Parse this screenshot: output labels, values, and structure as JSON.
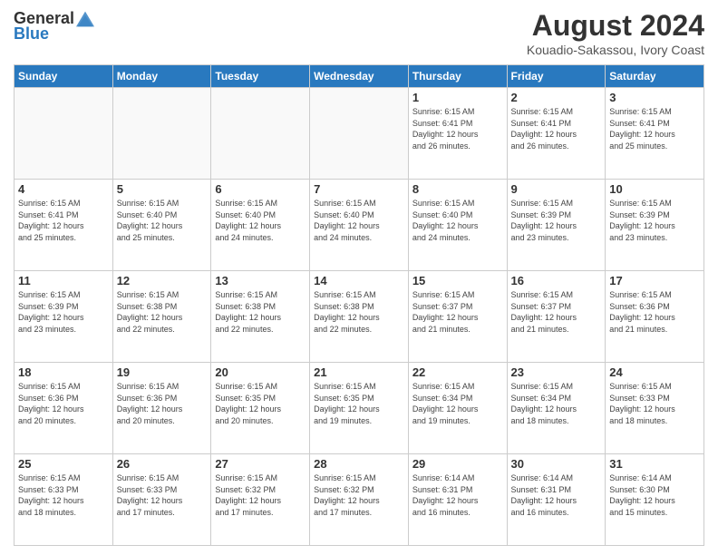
{
  "header": {
    "logo_line1": "General",
    "logo_line2": "Blue",
    "month_year": "August 2024",
    "location": "Kouadio-Sakassou, Ivory Coast"
  },
  "days_of_week": [
    "Sunday",
    "Monday",
    "Tuesday",
    "Wednesday",
    "Thursday",
    "Friday",
    "Saturday"
  ],
  "weeks": [
    [
      {
        "day": "",
        "info": ""
      },
      {
        "day": "",
        "info": ""
      },
      {
        "day": "",
        "info": ""
      },
      {
        "day": "",
        "info": ""
      },
      {
        "day": "1",
        "info": "Sunrise: 6:15 AM\nSunset: 6:41 PM\nDaylight: 12 hours\nand 26 minutes."
      },
      {
        "day": "2",
        "info": "Sunrise: 6:15 AM\nSunset: 6:41 PM\nDaylight: 12 hours\nand 26 minutes."
      },
      {
        "day": "3",
        "info": "Sunrise: 6:15 AM\nSunset: 6:41 PM\nDaylight: 12 hours\nand 25 minutes."
      }
    ],
    [
      {
        "day": "4",
        "info": "Sunrise: 6:15 AM\nSunset: 6:41 PM\nDaylight: 12 hours\nand 25 minutes."
      },
      {
        "day": "5",
        "info": "Sunrise: 6:15 AM\nSunset: 6:40 PM\nDaylight: 12 hours\nand 25 minutes."
      },
      {
        "day": "6",
        "info": "Sunrise: 6:15 AM\nSunset: 6:40 PM\nDaylight: 12 hours\nand 24 minutes."
      },
      {
        "day": "7",
        "info": "Sunrise: 6:15 AM\nSunset: 6:40 PM\nDaylight: 12 hours\nand 24 minutes."
      },
      {
        "day": "8",
        "info": "Sunrise: 6:15 AM\nSunset: 6:40 PM\nDaylight: 12 hours\nand 24 minutes."
      },
      {
        "day": "9",
        "info": "Sunrise: 6:15 AM\nSunset: 6:39 PM\nDaylight: 12 hours\nand 23 minutes."
      },
      {
        "day": "10",
        "info": "Sunrise: 6:15 AM\nSunset: 6:39 PM\nDaylight: 12 hours\nand 23 minutes."
      }
    ],
    [
      {
        "day": "11",
        "info": "Sunrise: 6:15 AM\nSunset: 6:39 PM\nDaylight: 12 hours\nand 23 minutes."
      },
      {
        "day": "12",
        "info": "Sunrise: 6:15 AM\nSunset: 6:38 PM\nDaylight: 12 hours\nand 22 minutes."
      },
      {
        "day": "13",
        "info": "Sunrise: 6:15 AM\nSunset: 6:38 PM\nDaylight: 12 hours\nand 22 minutes."
      },
      {
        "day": "14",
        "info": "Sunrise: 6:15 AM\nSunset: 6:38 PM\nDaylight: 12 hours\nand 22 minutes."
      },
      {
        "day": "15",
        "info": "Sunrise: 6:15 AM\nSunset: 6:37 PM\nDaylight: 12 hours\nand 21 minutes."
      },
      {
        "day": "16",
        "info": "Sunrise: 6:15 AM\nSunset: 6:37 PM\nDaylight: 12 hours\nand 21 minutes."
      },
      {
        "day": "17",
        "info": "Sunrise: 6:15 AM\nSunset: 6:36 PM\nDaylight: 12 hours\nand 21 minutes."
      }
    ],
    [
      {
        "day": "18",
        "info": "Sunrise: 6:15 AM\nSunset: 6:36 PM\nDaylight: 12 hours\nand 20 minutes."
      },
      {
        "day": "19",
        "info": "Sunrise: 6:15 AM\nSunset: 6:36 PM\nDaylight: 12 hours\nand 20 minutes."
      },
      {
        "day": "20",
        "info": "Sunrise: 6:15 AM\nSunset: 6:35 PM\nDaylight: 12 hours\nand 20 minutes."
      },
      {
        "day": "21",
        "info": "Sunrise: 6:15 AM\nSunset: 6:35 PM\nDaylight: 12 hours\nand 19 minutes."
      },
      {
        "day": "22",
        "info": "Sunrise: 6:15 AM\nSunset: 6:34 PM\nDaylight: 12 hours\nand 19 minutes."
      },
      {
        "day": "23",
        "info": "Sunrise: 6:15 AM\nSunset: 6:34 PM\nDaylight: 12 hours\nand 18 minutes."
      },
      {
        "day": "24",
        "info": "Sunrise: 6:15 AM\nSunset: 6:33 PM\nDaylight: 12 hours\nand 18 minutes."
      }
    ],
    [
      {
        "day": "25",
        "info": "Sunrise: 6:15 AM\nSunset: 6:33 PM\nDaylight: 12 hours\nand 18 minutes."
      },
      {
        "day": "26",
        "info": "Sunrise: 6:15 AM\nSunset: 6:33 PM\nDaylight: 12 hours\nand 17 minutes."
      },
      {
        "day": "27",
        "info": "Sunrise: 6:15 AM\nSunset: 6:32 PM\nDaylight: 12 hours\nand 17 minutes."
      },
      {
        "day": "28",
        "info": "Sunrise: 6:15 AM\nSunset: 6:32 PM\nDaylight: 12 hours\nand 17 minutes."
      },
      {
        "day": "29",
        "info": "Sunrise: 6:14 AM\nSunset: 6:31 PM\nDaylight: 12 hours\nand 16 minutes."
      },
      {
        "day": "30",
        "info": "Sunrise: 6:14 AM\nSunset: 6:31 PM\nDaylight: 12 hours\nand 16 minutes."
      },
      {
        "day": "31",
        "info": "Sunrise: 6:14 AM\nSunset: 6:30 PM\nDaylight: 12 hours\nand 15 minutes."
      }
    ]
  ]
}
